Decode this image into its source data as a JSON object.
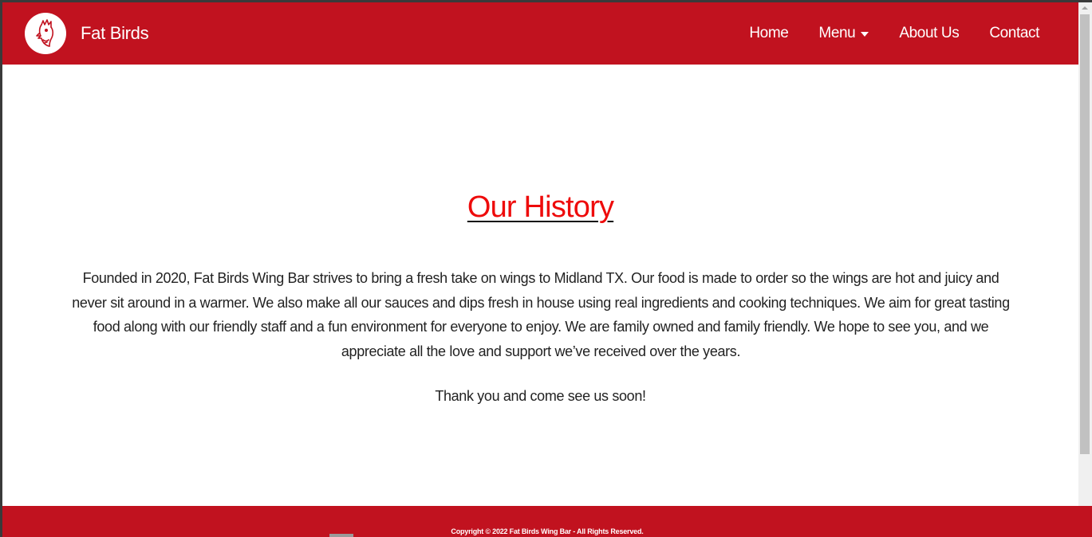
{
  "colors": {
    "brand_red": "#c1121f",
    "heading_red": "#ee0b0b",
    "body_text": "#222222",
    "nav_text": "#ffffff"
  },
  "navbar": {
    "logo_icon": "rooster-logo-icon",
    "brand": "Fat Birds",
    "links": [
      {
        "label": "Home"
      },
      {
        "label": "Menu",
        "has_dropdown": true
      },
      {
        "label": "About Us"
      },
      {
        "label": "Contact"
      }
    ]
  },
  "main": {
    "heading": "Our History",
    "paragraph": "Founded in 2020, Fat Birds Wing Bar strives to bring a fresh take on wings to Midland TX. Our food is made to order so the wings are hot and juicy and never sit around in a warmer. We also make all our sauces and dips fresh in house using real ingredients and cooking techniques. We aim for great tasting food along with our friendly staff and a fun environment for everyone to enjoy. We are family owned and family friendly. We hope to see you, and we appreciate all the love and support we’ve received over the years.",
    "closing": "Thank you and come see us soon!"
  },
  "footer": {
    "copyright": "Copyright © 2022 Fat Birds Wing Bar - All Rights Reserved."
  }
}
